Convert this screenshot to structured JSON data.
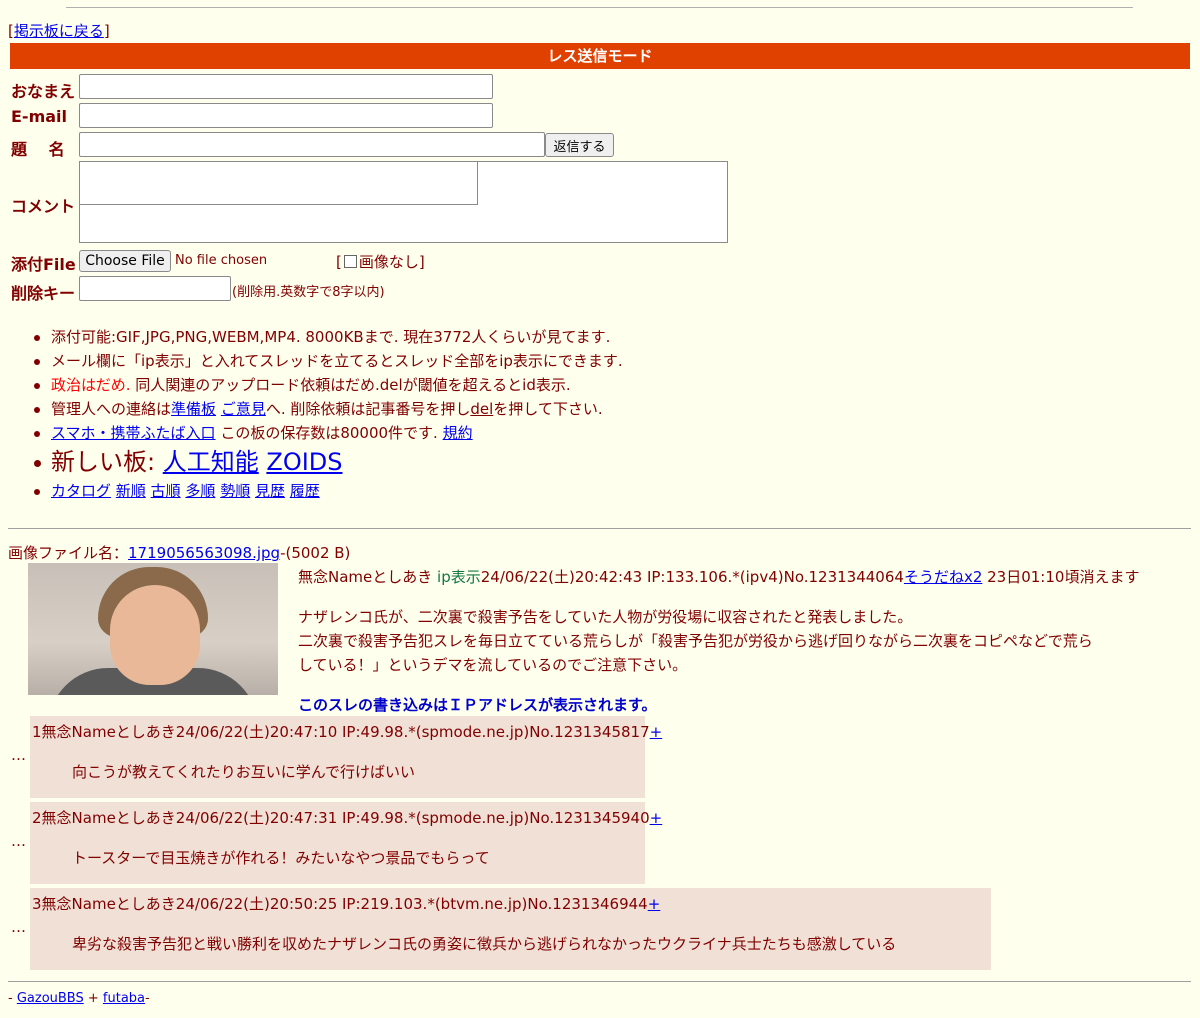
{
  "back": {
    "open": "[",
    "link": "掲示板に戻る",
    "close": "]"
  },
  "mode_title": "レス送信モード",
  "form": {
    "name_label": "おなまえ",
    "email_label": "E-mail",
    "subject_label": "題　 名",
    "submit_label": "返信する",
    "comment_label": "コメント",
    "file_label": "添付File",
    "choose_file": "Choose File",
    "no_file": "No file chosen",
    "no_image_open": "[",
    "no_image_label": "画像なし]",
    "delkey_label": "削除キー",
    "delkey_note": "(削除用.英数字で8字以内)"
  },
  "rules": {
    "r1": "添付可能:GIF,JPG,PNG,WEBM,MP4. 8000KBまで. 現在3772人くらいが見てます.",
    "r2": "メール欄に「ip表示」と入れてスレッドを立てるとスレッド全部をip表示にできます.",
    "r3_red": "政治はだめ.",
    "r3_rest": " 同人関連のアップロード依頼はだめ.delが閾値を超えるとid表示.",
    "r4_a": "管理人への連絡は",
    "r4_link1": "準備板",
    "r4_link2": "ご意見",
    "r4_b": "へ. 削除依頼は記事番号を押し",
    "r4_del": "del",
    "r4_c": "を押して下さい.",
    "r5_link": "スマホ・携帯ふたば入口",
    "r5_text": " この板の保存数は80000件です.",
    "r5_link2": "規約",
    "r6_text": "新しい板:",
    "r6_link1": "人工知能",
    "r6_link2": "ZOIDS",
    "nav": [
      "カタログ",
      "新順",
      "古順",
      "多順",
      "勢順",
      "見歴",
      "履歴"
    ]
  },
  "thread": {
    "file_prefix": "画像ファイル名：",
    "file_name": "1719056563098.jpg",
    "file_size": "-(5002 B)",
    "op_name": "無念Nameとしあき",
    "op_ip_tag": "ip表示",
    "op_meta": "24/06/22(土)20:42:43 IP:133.106.*(ipv4)No.1231344064",
    "op_sodane": "そうだねx2",
    "op_expire": " 23日01:10頃消えます",
    "op_body1": "ナザレンコ氏が、二次裏で殺害予告をしていた人物が労役場に収容されたと発表しました。",
    "op_body2": "二次裏で殺害予告犯スレを毎日立てている荒らしが「殺害予告犯が労役から逃げ回りながら二次裏をコピペなどで荒ら",
    "op_body3": "している！」というデマを流しているのでご注意下さい。",
    "notice": "このスレの書き込みはＩＰアドレスが表示されます。"
  },
  "replies": [
    {
      "dots": "…",
      "head": "1無念Nameとしあき24/06/22(土)20:47:10 IP:49.98.*(spmode.ne.jp)No.1231345817",
      "plus": "+",
      "body": "向こうが教えてくれたりお互いに学んで行けばいい"
    },
    {
      "dots": "…",
      "head": "2無念Nameとしあき24/06/22(土)20:47:31 IP:49.98.*(spmode.ne.jp)No.1231345940",
      "plus": "+",
      "body": "トースターで目玉焼きが作れる！みたいなやつ景品でもらって"
    },
    {
      "dots": "…",
      "head": "3無念Nameとしあき24/06/22(土)20:50:25 IP:219.103.*(btvm.ne.jp)No.1231346944",
      "plus": "+",
      "body": "卑劣な殺害予告犯と戦い勝利を収めたナザレンコ氏の勇姿に徴兵から逃げられなかったウクライナ兵士たちも感激している"
    }
  ],
  "footer": {
    "dash1": "- ",
    "link1": "GazouBBS",
    "plus": " + ",
    "link2": "futaba",
    "dash2": "-"
  }
}
